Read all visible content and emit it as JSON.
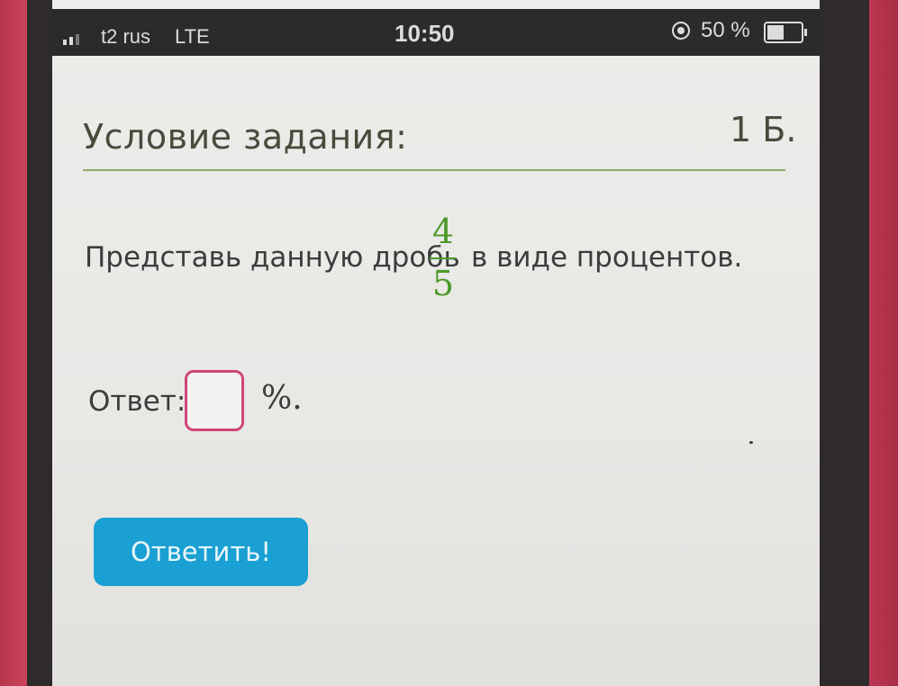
{
  "status_bar": {
    "carrier": "t2 rus",
    "network": "LTE",
    "time": "10:50",
    "battery": "50 %"
  },
  "task": {
    "title": "Условие задания:",
    "points": "1 Б.",
    "question_before": "Представь данную дробь",
    "question_after": "в виде процентов.",
    "fraction": {
      "numerator": "4",
      "denominator": "5"
    },
    "answer_label": "Ответ:",
    "answer_value": "",
    "answer_unit": "%.",
    "submit_label": "Ответить!"
  },
  "colors": {
    "accent_green": "#4d9a2a",
    "rule_green": "#8fa86a",
    "input_border": "#d0457a",
    "button_blue": "#1aa0d2"
  }
}
